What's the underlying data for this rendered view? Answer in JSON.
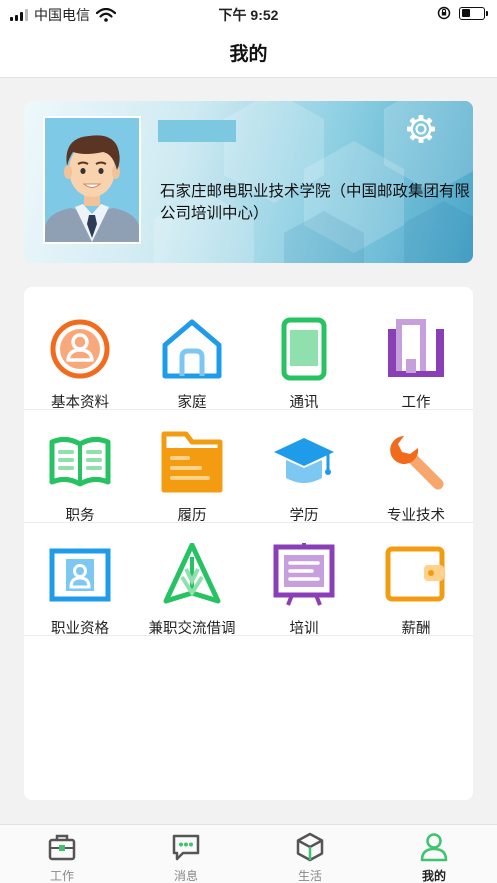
{
  "status_bar": {
    "carrier": "中国电信",
    "time": "下午 9:52",
    "battery_level": 0.4
  },
  "nav": {
    "title": "我的"
  },
  "profile": {
    "organization": "石家庄邮电职业技术学院（中国邮政集团有限公司培训中心）"
  },
  "menu": {
    "rows": [
      [
        {
          "label": "基本资料",
          "icon": "person-circle-icon"
        },
        {
          "label": "家庭",
          "icon": "house-icon"
        },
        {
          "label": "通讯",
          "icon": "phone-icon"
        },
        {
          "label": "工作",
          "icon": "building-icon"
        }
      ],
      [
        {
          "label": "职务",
          "icon": "open-book-icon"
        },
        {
          "label": "履历",
          "icon": "folder-icon"
        },
        {
          "label": "学历",
          "icon": "graduation-cap-icon"
        },
        {
          "label": "专业技术",
          "icon": "wrench-icon"
        }
      ],
      [
        {
          "label": "职业资格",
          "icon": "id-card-icon"
        },
        {
          "label": "兼职交流借调",
          "icon": "paper-plane-icon"
        },
        {
          "label": "培训",
          "icon": "easel-icon"
        },
        {
          "label": "薪酬",
          "icon": "wallet-icon"
        }
      ]
    ]
  },
  "tabbar": {
    "active_color": "#3cc46e",
    "items": [
      {
        "label": "工作",
        "icon": "briefcase-icon"
      },
      {
        "label": "消息",
        "icon": "chat-bubble-icon"
      },
      {
        "label": "生活",
        "icon": "cube-icon"
      },
      {
        "label": "我的",
        "icon": "person-icon"
      }
    ]
  }
}
